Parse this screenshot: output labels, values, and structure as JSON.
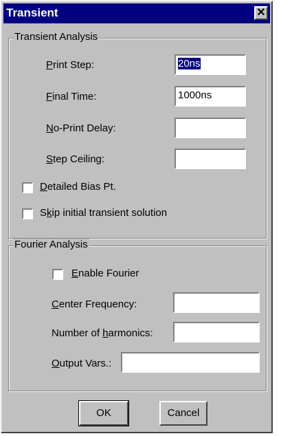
{
  "window": {
    "title": "Transient",
    "close_glyph": "✕"
  },
  "transient": {
    "legend": "Transient Analysis",
    "print_step": {
      "label_pre": "",
      "label_u": "P",
      "label_post": "rint Step:",
      "value": "20ns"
    },
    "final_time": {
      "label_pre": "",
      "label_u": "F",
      "label_post": "inal Time:",
      "value": "1000ns"
    },
    "no_print_delay": {
      "label_pre": "",
      "label_u": "N",
      "label_post": "o-Print Delay:",
      "value": ""
    },
    "step_ceiling": {
      "label_pre": "",
      "label_u": "S",
      "label_post": "tep Ceiling:",
      "value": ""
    },
    "detailed_bias": {
      "label_pre": "",
      "label_u": "D",
      "label_post": "etailed Bias Pt.",
      "checked": false
    },
    "skip_initial": {
      "label_pre": "S",
      "label_u": "k",
      "label_post": "ip initial transient solution",
      "checked": false
    }
  },
  "fourier": {
    "legend": "Fourier Analysis",
    "enable": {
      "label_pre": "",
      "label_u": "E",
      "label_post": "nable Fourier",
      "checked": false
    },
    "center_freq": {
      "label_pre": "",
      "label_u": "C",
      "label_post": "enter Frequency:",
      "value": ""
    },
    "harmonics": {
      "label_pre": "Number of ",
      "label_u": "h",
      "label_post": "armonics:",
      "value": ""
    },
    "output_vars": {
      "label_pre": "",
      "label_u": "O",
      "label_post": "utput Vars.:",
      "value": ""
    }
  },
  "buttons": {
    "ok": "OK",
    "cancel": "Cancel"
  }
}
